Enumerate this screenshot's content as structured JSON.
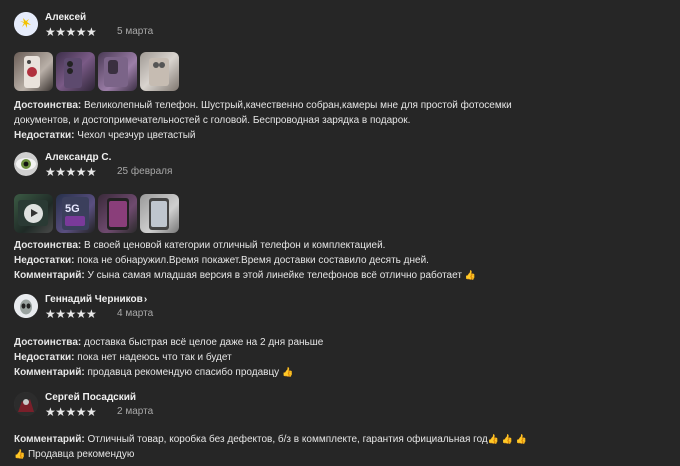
{
  "reviews": [
    {
      "author": "Алексей",
      "stars": "★★★★★",
      "date": "5 марта",
      "lines": [
        {
          "label": "Достоинства:",
          "text": " Великолепный телефон. Шустрый,качественно собран,камеры мне для простой фотосемки"
        },
        {
          "label": "",
          "text": "документов, и достопримечательностей с головой. Беспроводная зарядка в подарок."
        },
        {
          "label": "Недостатки:",
          "text": " Чехол чрезчур цветастый"
        }
      ]
    },
    {
      "author": "Александр С.",
      "stars": "★★★★★",
      "date": "25 февраля",
      "lines": [
        {
          "label": "Достоинства:",
          "text": " В своей ценовой категории отличный телефон и комплектацией."
        },
        {
          "label": "Недостатки:",
          "text": " пока не обнаружил.Время покажет.Время доставки составило десять дней."
        },
        {
          "label": "Комментарий:",
          "text": " У сына самая младшая версия в этой линейке телефонов всё отлично работает"
        }
      ]
    },
    {
      "author": "Геннадий Черников",
      "stars": "★★★★★",
      "date": "4 марта",
      "lines": [
        {
          "label": "Достоинства:",
          "text": " доставка быстрая всё целое даже на 2 дня раньше"
        },
        {
          "label": "Недостатки:",
          "text": " пока нет надеюсь что так и будет"
        },
        {
          "label": "Комментарий:",
          "text": " продавца рекомендую спасибо продавцу"
        }
      ]
    },
    {
      "author": "Сергей Посадский",
      "stars": "★★★★★",
      "date": "2 марта",
      "lines": [
        {
          "label": "Комментарий:",
          "text": " Отличный товар, коробка без дефектов, б/з в коммплекте, гарантия официальная год"
        },
        {
          "label": "",
          "text": " Продавца рекомендую"
        }
      ]
    }
  ],
  "author_link_glyph": "›",
  "thumbs_up": "👍"
}
